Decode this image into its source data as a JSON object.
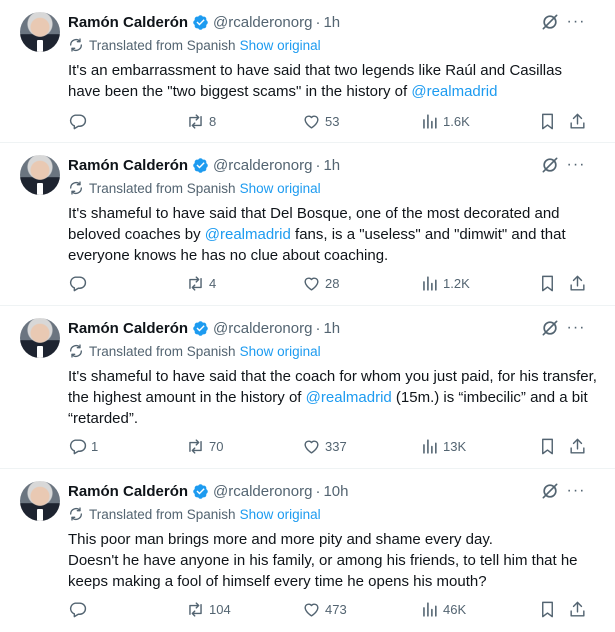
{
  "tweets": [
    {
      "name": "Ramón Calderón",
      "handle": "@rcalderonorg",
      "time": "1h",
      "translated_label": "Translated from Spanish",
      "show_original": "Show original",
      "body": [
        {
          "t": "It's an embarrassment to have said that two legends like Raúl and Casillas have been the \"two biggest scams\" in the history of "
        },
        {
          "m": "@realmadrid"
        }
      ],
      "stats": {
        "replies": "",
        "reposts": "8",
        "likes": "53",
        "views": "1.6K"
      }
    },
    {
      "name": "Ramón Calderón",
      "handle": "@rcalderonorg",
      "time": "1h",
      "translated_label": "Translated from Spanish",
      "show_original": "Show original",
      "body": [
        {
          "t": "It's shameful to have said that Del Bosque, one of the most decorated and beloved coaches by "
        },
        {
          "m": "@realmadrid"
        },
        {
          "t": " fans, is a \"useless\" and \"dimwit\" and that everyone knows he has no clue about coaching."
        }
      ],
      "stats": {
        "replies": "",
        "reposts": "4",
        "likes": "28",
        "views": "1.2K"
      }
    },
    {
      "name": "Ramón Calderón",
      "handle": "@rcalderonorg",
      "time": "1h",
      "translated_label": "Translated from Spanish",
      "show_original": "Show original",
      "body": [
        {
          "t": "It's shameful to have said that the coach for whom you just paid, for his transfer, the highest amount in the history of "
        },
        {
          "m": "@realmadrid"
        },
        {
          "t": " (15m.) is “imbecilic” and a bit “retarded”."
        }
      ],
      "stats": {
        "replies": "1",
        "reposts": "70",
        "likes": "337",
        "views": "13K"
      }
    },
    {
      "name": "Ramón Calderón",
      "handle": "@rcalderonorg",
      "time": "10h",
      "translated_label": "Translated from Spanish",
      "show_original": "Show original",
      "body": [
        {
          "t": "This poor man brings more and more pity and shame every day.\nDoesn't he have anyone in his family, or among his friends, to tell him that he keeps making a fool of himself every time he opens his mouth?"
        }
      ],
      "stats": {
        "replies": "",
        "reposts": "104",
        "likes": "473",
        "views": "46K"
      }
    }
  ],
  "icons": {
    "verified": "verified-badge-icon",
    "grok": "grok-icon",
    "more": "more-icon",
    "translate": "translate-icon",
    "reply": "reply-icon",
    "repost": "repost-icon",
    "like": "like-icon",
    "views": "views-icon",
    "bookmark": "bookmark-icon",
    "share": "share-icon"
  },
  "colors": {
    "link": "#1d9bf0",
    "verified": "#1d9bf0",
    "muted": "#536471",
    "text": "#0f1419"
  }
}
